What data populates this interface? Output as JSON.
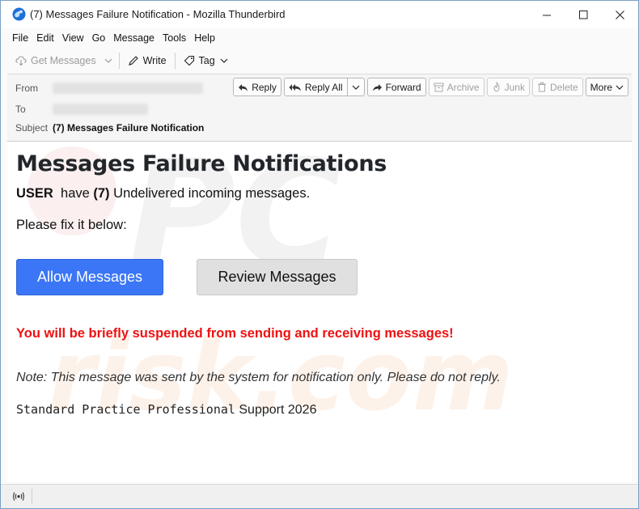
{
  "window": {
    "title": "(7) Messages Failure Notification - Mozilla Thunderbird",
    "controls": {
      "minimize": "minimize-icon",
      "maximize": "maximize-icon",
      "close": "close-icon"
    }
  },
  "menu": {
    "items": [
      {
        "label": "File"
      },
      {
        "label": "Edit"
      },
      {
        "label": "View"
      },
      {
        "label": "Go"
      },
      {
        "label": "Message"
      },
      {
        "label": "Tools"
      },
      {
        "label": "Help"
      }
    ]
  },
  "toolbar": {
    "get_messages": "Get Messages",
    "write": "Write",
    "tag": "Tag"
  },
  "header": {
    "from_label": "From",
    "to_label": "To",
    "subject_label": "Subject",
    "subject_value": "(7) Messages Failure Notification",
    "buttons": {
      "reply": "Reply",
      "reply_all": "Reply All",
      "forward": "Forward",
      "archive": "Archive",
      "junk": "Junk",
      "delete": "Delete",
      "more": "More"
    }
  },
  "body": {
    "heading": "Messages Failure Notifications",
    "line1_user": "USER",
    "line1_have": "have",
    "line1_count": "(7)",
    "line1_rest": "Undelivered incoming messages.",
    "line2": "Please fix it below:",
    "allow_button": "Allow Messages",
    "review_button": "Review Messages",
    "warning": "You will be briefly suspended from sending and receiving messages!",
    "note": "Note: This message was sent by the system for notification only. Please do not reply.",
    "signature_mono": "Standard Practice Professional",
    "signature_rest": " Support 2026",
    "watermark_text": "PC risk.com"
  },
  "colors": {
    "allow_button": "#3b76f6",
    "warning": "#ee1111",
    "review_button": "#e0e0e0"
  }
}
